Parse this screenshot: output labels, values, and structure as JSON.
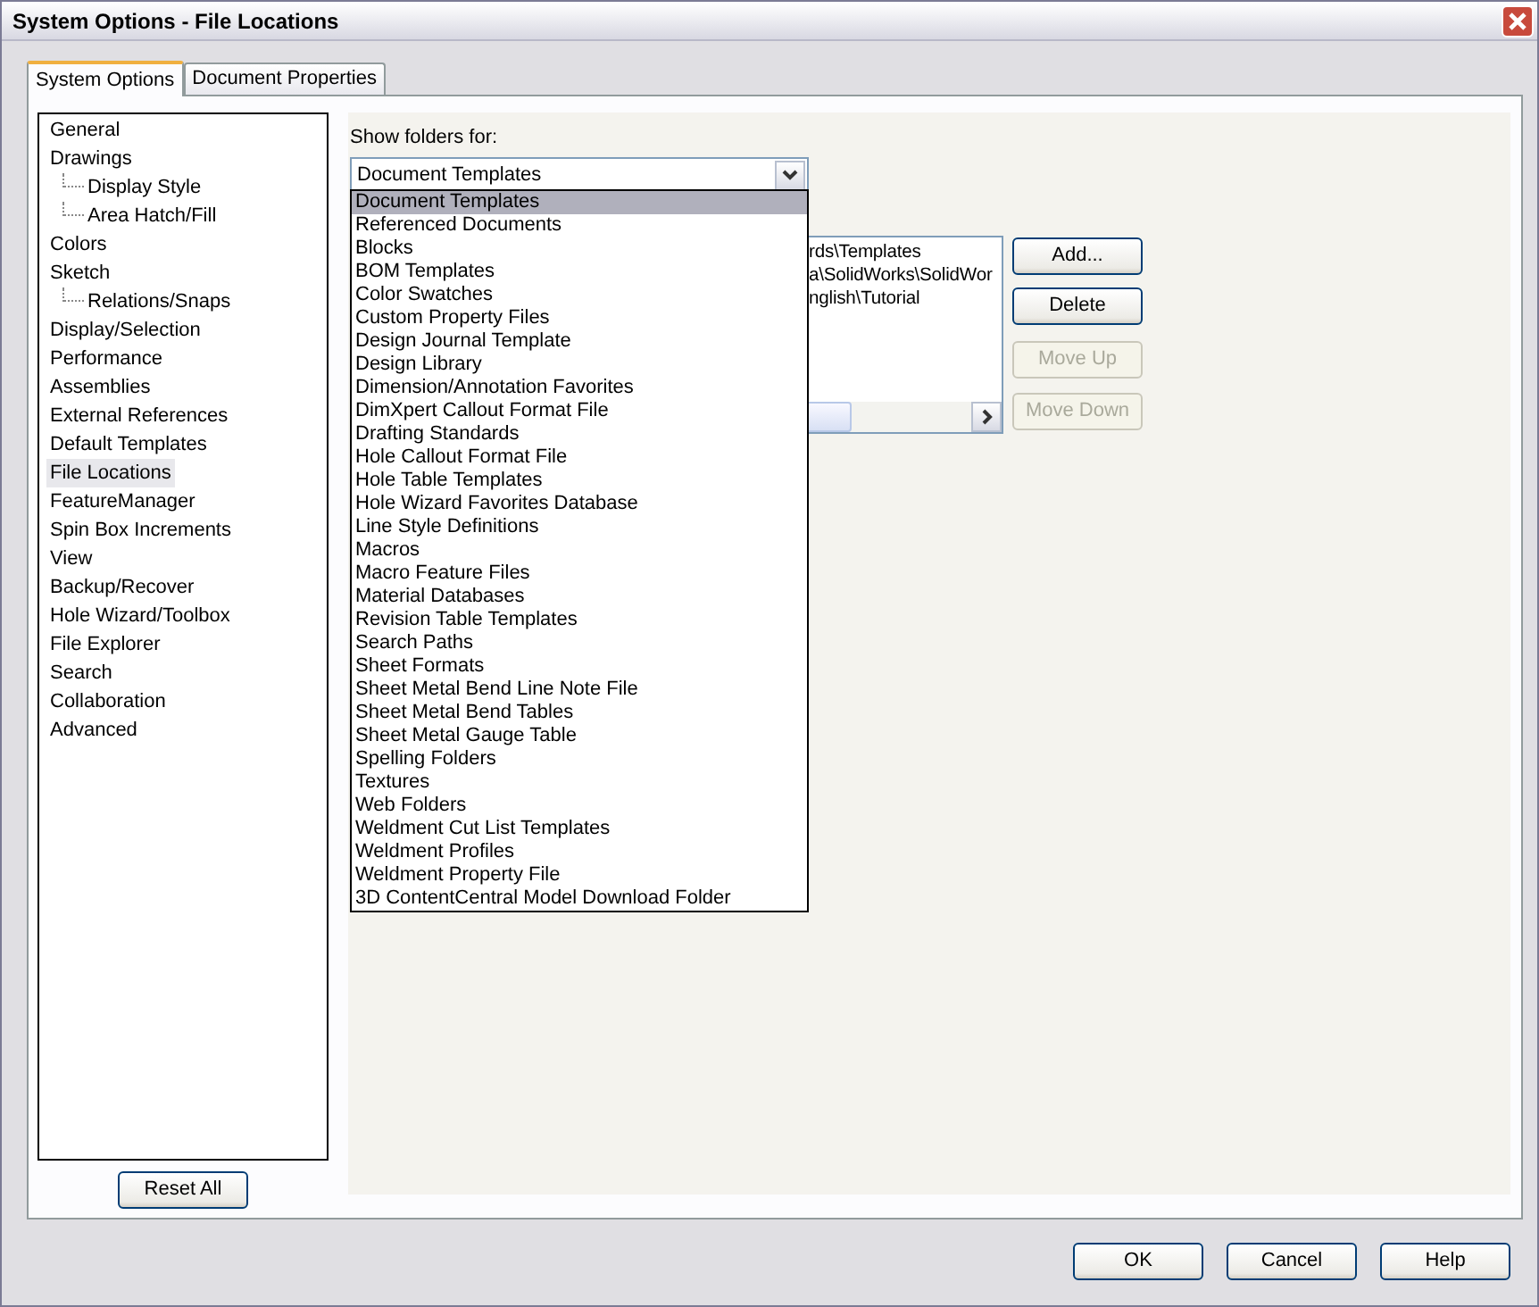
{
  "window": {
    "title": "System Options - File Locations"
  },
  "tabs": [
    {
      "label": "System Options",
      "selected": true
    },
    {
      "label": "Document Properties",
      "selected": false
    }
  ],
  "tree": {
    "items": [
      {
        "label": "General",
        "selected": false
      },
      {
        "label": "Drawings",
        "selected": false,
        "children": [
          {
            "label": "Display Style",
            "selected": false
          },
          {
            "label": "Area Hatch/Fill",
            "selected": false
          }
        ]
      },
      {
        "label": "Colors",
        "selected": false
      },
      {
        "label": "Sketch",
        "selected": false,
        "children": [
          {
            "label": "Relations/Snaps",
            "selected": false
          }
        ]
      },
      {
        "label": "Display/Selection",
        "selected": false
      },
      {
        "label": "Performance",
        "selected": false
      },
      {
        "label": "Assemblies",
        "selected": false
      },
      {
        "label": "External References",
        "selected": false
      },
      {
        "label": "Default Templates",
        "selected": false
      },
      {
        "label": "File Locations",
        "selected": true
      },
      {
        "label": "FeatureManager",
        "selected": false
      },
      {
        "label": "Spin Box Increments",
        "selected": false
      },
      {
        "label": "View",
        "selected": false
      },
      {
        "label": "Backup/Recover",
        "selected": false
      },
      {
        "label": "Hole Wizard/Toolbox",
        "selected": false
      },
      {
        "label": "File Explorer",
        "selected": false
      },
      {
        "label": "Search",
        "selected": false
      },
      {
        "label": "Collaboration",
        "selected": false
      },
      {
        "label": "Advanced",
        "selected": false
      }
    ]
  },
  "reset_button": "Reset All",
  "show_folders": {
    "label": "Show folders for:",
    "value": "Document Templates",
    "options": [
      {
        "label": "Document Templates",
        "selected": true
      },
      {
        "label": "Referenced Documents",
        "selected": false
      },
      {
        "label": "Blocks",
        "selected": false
      },
      {
        "label": "BOM Templates",
        "selected": false
      },
      {
        "label": "Color Swatches",
        "selected": false
      },
      {
        "label": "Custom Property Files",
        "selected": false
      },
      {
        "label": "Design Journal Template",
        "selected": false
      },
      {
        "label": "Design Library",
        "selected": false
      },
      {
        "label": "Dimension/Annotation Favorites",
        "selected": false
      },
      {
        "label": "DimXpert Callout Format File",
        "selected": false
      },
      {
        "label": "Drafting Standards",
        "selected": false
      },
      {
        "label": "Hole Callout Format File",
        "selected": false
      },
      {
        "label": "Hole Table Templates",
        "selected": false
      },
      {
        "label": "Hole Wizard Favorites Database",
        "selected": false
      },
      {
        "label": "Line Style Definitions",
        "selected": false
      },
      {
        "label": "Macros",
        "selected": false
      },
      {
        "label": "Macro Feature Files",
        "selected": false
      },
      {
        "label": "Material Databases",
        "selected": false
      },
      {
        "label": "Revision Table Templates",
        "selected": false
      },
      {
        "label": "Search Paths",
        "selected": false
      },
      {
        "label": "Sheet Formats",
        "selected": false
      },
      {
        "label": "Sheet Metal Bend Line Note File",
        "selected": false
      },
      {
        "label": "Sheet Metal Bend Tables",
        "selected": false
      },
      {
        "label": "Sheet Metal Gauge Table",
        "selected": false
      },
      {
        "label": "Spelling Folders",
        "selected": false
      },
      {
        "label": "Textures",
        "selected": false
      },
      {
        "label": "Web Folders",
        "selected": false
      },
      {
        "label": "Weldment Cut List Templates",
        "selected": false
      },
      {
        "label": "Weldment Profiles",
        "selected": false
      },
      {
        "label": "Weldment Property File",
        "selected": false
      },
      {
        "label": "3D ContentCentral Model Download Folder",
        "selected": false
      }
    ]
  },
  "folders": {
    "lines": [
      "rds\\Templates",
      "a\\SolidWorks\\SolidWor",
      "nglish\\Tutorial"
    ]
  },
  "side_buttons": [
    {
      "label": "Add...",
      "disabled": false
    },
    {
      "label": "Delete",
      "disabled": false
    },
    {
      "label": "Move Up",
      "disabled": true
    },
    {
      "label": "Move Down",
      "disabled": true
    }
  ],
  "dialog_buttons": [
    "OK",
    "Cancel",
    "Help"
  ]
}
